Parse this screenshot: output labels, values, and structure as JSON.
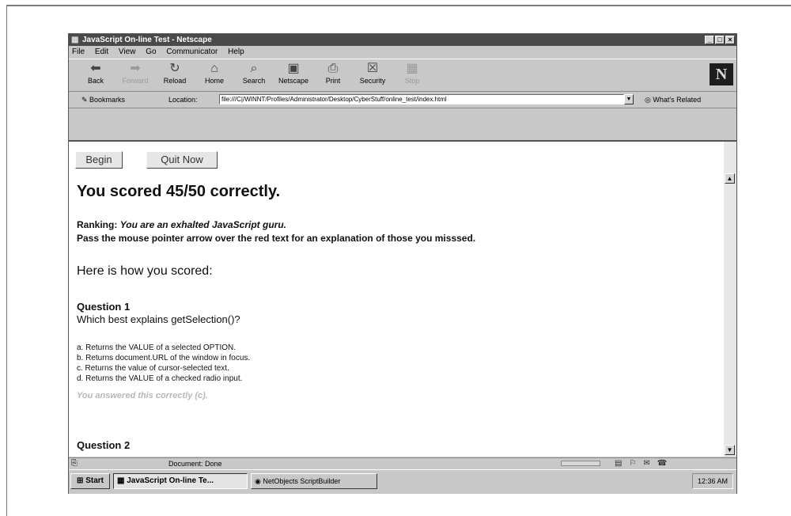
{
  "window": {
    "title": "JavaScript On-line Test - Netscape",
    "controls": [
      "_",
      "□",
      "×"
    ]
  },
  "menu": [
    "File",
    "Edit",
    "View",
    "Go",
    "Communicator",
    "Help"
  ],
  "toolbar": {
    "buttons": [
      {
        "label": "Back",
        "icon": "back-arrow-icon",
        "glyph": "⬅",
        "enabled": true
      },
      {
        "label": "Forward",
        "icon": "forward-arrow-icon",
        "glyph": "➡",
        "enabled": false
      },
      {
        "label": "Reload",
        "icon": "reload-icon",
        "glyph": "↻",
        "enabled": true
      },
      {
        "label": "Home",
        "icon": "home-icon",
        "glyph": "⌂",
        "enabled": true
      },
      {
        "label": "Search",
        "icon": "search-icon",
        "glyph": "⌕",
        "enabled": true
      },
      {
        "label": "Netscape",
        "icon": "netscape-icon",
        "glyph": "▣",
        "enabled": true
      },
      {
        "label": "Print",
        "icon": "print-icon",
        "glyph": "⎙",
        "enabled": true
      },
      {
        "label": "Security",
        "icon": "lock-icon",
        "glyph": "☒",
        "enabled": true
      },
      {
        "label": "Stop",
        "icon": "stop-icon",
        "glyph": "▦",
        "enabled": false
      }
    ],
    "logo": "N"
  },
  "location": {
    "bookmarks_label": "Bookmarks",
    "location_label": "Location:",
    "url": "file:///C|/WINNT/Profiles/Administrator/Desktop/CyberStuff/online_test/index.html",
    "related_label": "What's Related"
  },
  "page": {
    "begin_label": "Begin",
    "quit_label": "Quit Now",
    "score_heading": "You scored 45/50 correctly.",
    "ranking_label": "Ranking:",
    "ranking_value": "You are an exhalted JavaScript guru.",
    "instructions": "Pass the mouse pointer arrow over the red text for an explanation of those you misssed.",
    "how_heading": "Here is how you scored:",
    "questions": [
      {
        "heading": "Question 1",
        "text": "Which best explains getSelection()?",
        "options": [
          "a. Returns the VALUE of a selected OPTION.",
          "b. Returns document.URL of the window in focus.",
          "c. Returns the value of cursor-selected text.",
          "d. Returns the VALUE of a checked radio input."
        ],
        "result": "You answered this correctly (c)."
      },
      {
        "heading": "Question 2"
      }
    ]
  },
  "status": {
    "text": "Document: Done"
  },
  "taskbar": {
    "start_label": "Start",
    "tasks": [
      "JavaScript On-line Te...",
      "NetObjects ScriptBuilder"
    ],
    "clock": "12:36 AM"
  }
}
